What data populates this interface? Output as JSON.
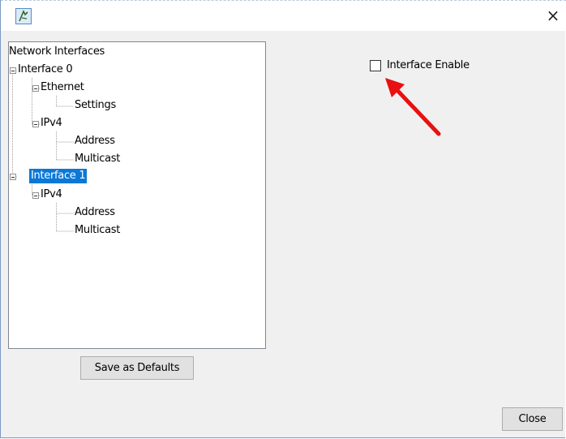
{
  "window": {
    "close_glyph": "×",
    "app_icon": "app-icon"
  },
  "tree": {
    "root": "Network Interfaces",
    "nodes": [
      {
        "label": "Interface 0",
        "level": 1,
        "expanded": true
      },
      {
        "label": "Ethernet",
        "level": 2,
        "expanded": true
      },
      {
        "label": "Settings",
        "level": 3
      },
      {
        "label": "IPv4",
        "level": 2,
        "expanded": true
      },
      {
        "label": "Address",
        "level": 3
      },
      {
        "label": "Multicast",
        "level": 3
      },
      {
        "label": "Interface 1",
        "level": 1,
        "expanded": true,
        "selected": true
      },
      {
        "label": "IPv4",
        "level": 2,
        "expanded": true
      },
      {
        "label": "Address",
        "level": 3
      },
      {
        "label": "Multicast",
        "level": 3
      }
    ]
  },
  "options": {
    "interface_enable_label": "Interface Enable",
    "interface_enable_checked": false
  },
  "buttons": {
    "save_defaults": "Save as Defaults",
    "close": "Close"
  },
  "colors": {
    "selection": "#0a78d7",
    "annotation_arrow": "#e81010"
  }
}
